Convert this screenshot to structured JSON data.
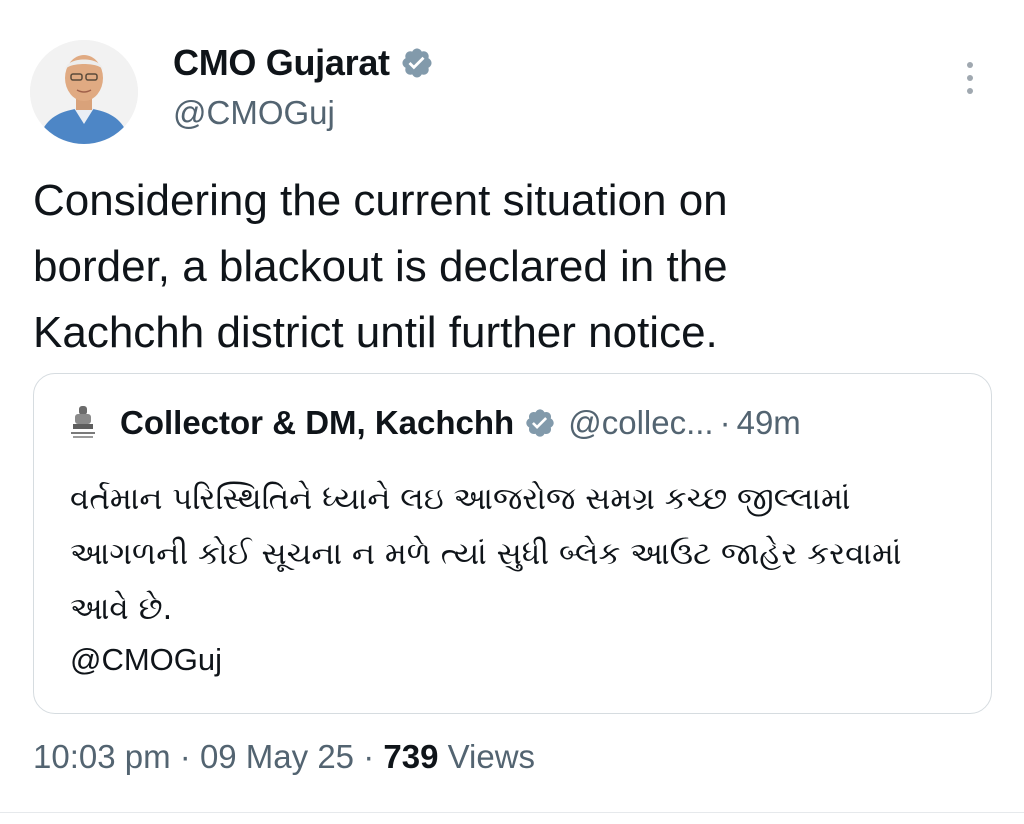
{
  "author": {
    "name": "CMO Gujarat",
    "handle": "@CMOGuj"
  },
  "tweet": {
    "lines": [
      "Considering the current situation on",
      "border, a blackout is declared in the",
      "Kachchh district until further notice."
    ]
  },
  "quote": {
    "name": "Collector & DM, Kachchh",
    "handle": "@collec...",
    "separator": "·",
    "time": "49m",
    "lines": [
      "વર્તમાન પરિસ્થિતિને ધ્યાને લઇ આજરોજ સમગ્ર કચ્છ જીલ્લામાં",
      "આગળની કોઈ સૂચના ન મળે ત્યાં સુધી બ્લેક આઉટ જાહેર કરવામાં",
      "આવે છે."
    ],
    "mention": "@CMOGuj"
  },
  "meta": {
    "time": "10:03 pm",
    "sep1": "·",
    "date": "09 May 25",
    "sep2": "·",
    "views_count": "739",
    "views_label": "Views"
  },
  "icons": {
    "verified": "verified-badge-icon",
    "more": "more-options-icon",
    "emblem": "state-emblem-icon"
  },
  "colors": {
    "text": "#0f1419",
    "secondary": "#536471",
    "border": "#d6dce0",
    "verified_badge": "#829aab"
  }
}
